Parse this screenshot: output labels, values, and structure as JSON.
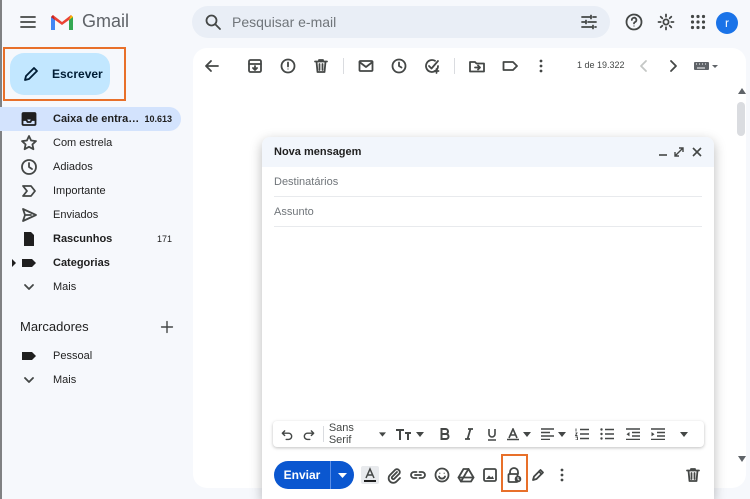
{
  "header": {
    "menu_icon": "hamburger-menu-icon",
    "app_name": "Gmail",
    "search_placeholder": "Pesquisar e-mail",
    "avatar_initial": "r"
  },
  "sidebar": {
    "compose_label": "Escrever",
    "items": [
      {
        "label": "Caixa de entra…",
        "count": "10.613",
        "icon": "inbox-icon"
      },
      {
        "label": "Com estrela",
        "count": "",
        "icon": "star-icon"
      },
      {
        "label": "Adiados",
        "count": "",
        "icon": "clock-icon"
      },
      {
        "label": "Importante",
        "count": "",
        "icon": "important-icon"
      },
      {
        "label": "Enviados",
        "count": "",
        "icon": "send-icon"
      },
      {
        "label": "Rascunhos",
        "count": "171",
        "icon": "draft-icon"
      },
      {
        "label": "Categorias",
        "count": "",
        "icon": "label-icon"
      },
      {
        "label": "Mais",
        "count": "",
        "icon": "chevron-down-icon"
      }
    ],
    "labels_title": "Marcadores",
    "labels": [
      {
        "label": "Pessoal",
        "icon": "label-icon"
      },
      {
        "label": "Mais",
        "icon": "chevron-down-icon"
      }
    ]
  },
  "toolbar": {
    "pager_text": "1 de 19.322"
  },
  "compose": {
    "title": "Nova mensagem",
    "to_placeholder": "Destinatários",
    "subject_placeholder": "Assunto",
    "font_name": "Sans Serif",
    "send_label": "Enviar"
  },
  "colors": {
    "accent": "#0b57d0",
    "highlight": "#e8702a",
    "active_nav": "#d3e3fd",
    "compose_btn": "#c2e7ff"
  }
}
